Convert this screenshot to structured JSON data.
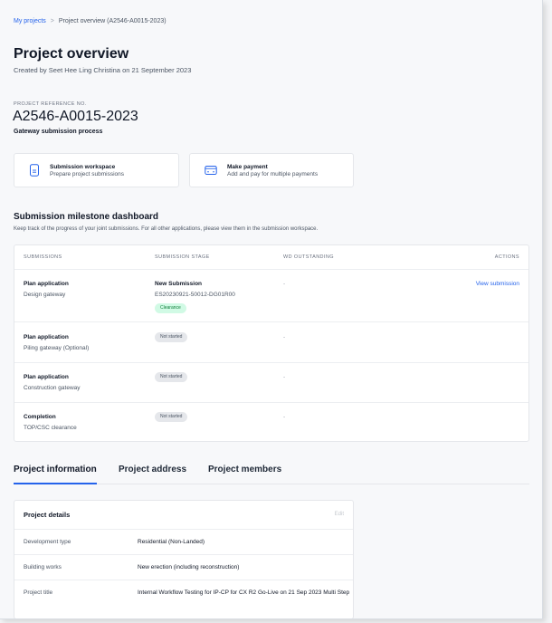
{
  "breadcrumb": {
    "root": "My projects",
    "separator": ">",
    "current": "Project overview (A2546-A0015-2023)"
  },
  "header": {
    "title": "Project overview",
    "created_by": "Created by Seet Hee Ling Christina on 21 September 2023"
  },
  "project": {
    "ref_label": "PROJECT REFERENCE NO.",
    "ref_number": "A2546-A0015-2023",
    "process": "Gateway submission process"
  },
  "actions": [
    {
      "title": "Submission workspace",
      "subtitle": "Prepare project submissions",
      "icon": "document-icon"
    },
    {
      "title": "Make payment",
      "subtitle": "Add and pay for multiple payments",
      "icon": "payment-card-icon"
    }
  ],
  "milestone": {
    "title": "Submission milestone dashboard",
    "subtitle": "Keep track of the progress of your joint submissions. For all other applications, please view them in the submission workspace.",
    "columns": [
      "SUBMISSIONS",
      "SUBMISSION STAGE",
      "WD OUTSTANDING",
      "ACTIONS"
    ],
    "rows": [
      {
        "title": "Plan application",
        "subtitle": "Design gateway",
        "stage_title": "New Submission",
        "stage_code": "ES20230921-50012-DG01R00",
        "status": "Clearance",
        "wd": "-",
        "action": "View submission"
      },
      {
        "title": "Plan application",
        "subtitle": "Piling gateway (Optional)",
        "status": "Not started",
        "wd": "-"
      },
      {
        "title": "Plan application",
        "subtitle": "Construction gateway",
        "status": "Not started",
        "wd": "-"
      },
      {
        "title": "Completion",
        "subtitle": "TOP/CSC clearance",
        "status": "Not started",
        "wd": "-"
      }
    ]
  },
  "tabs": [
    "Project information",
    "Project address",
    "Project members"
  ],
  "details": {
    "title": "Project details",
    "edit": "Edit",
    "rows": [
      {
        "label": "Development type",
        "value": "Residential (Non-Landed)"
      },
      {
        "label": "Building works",
        "value": "New erection (including reconstruction)"
      },
      {
        "label": "Project title",
        "value": "Internal Workflow Testing for IP-CP for CX R2 Go-Live on 21 Sep 2023 Multi Step"
      }
    ]
  },
  "colors": {
    "accent": "#2563eb",
    "clearance_bg": "#d1fae5",
    "clearance_text": "#15803d",
    "not_started_bg": "#e5e7eb"
  }
}
